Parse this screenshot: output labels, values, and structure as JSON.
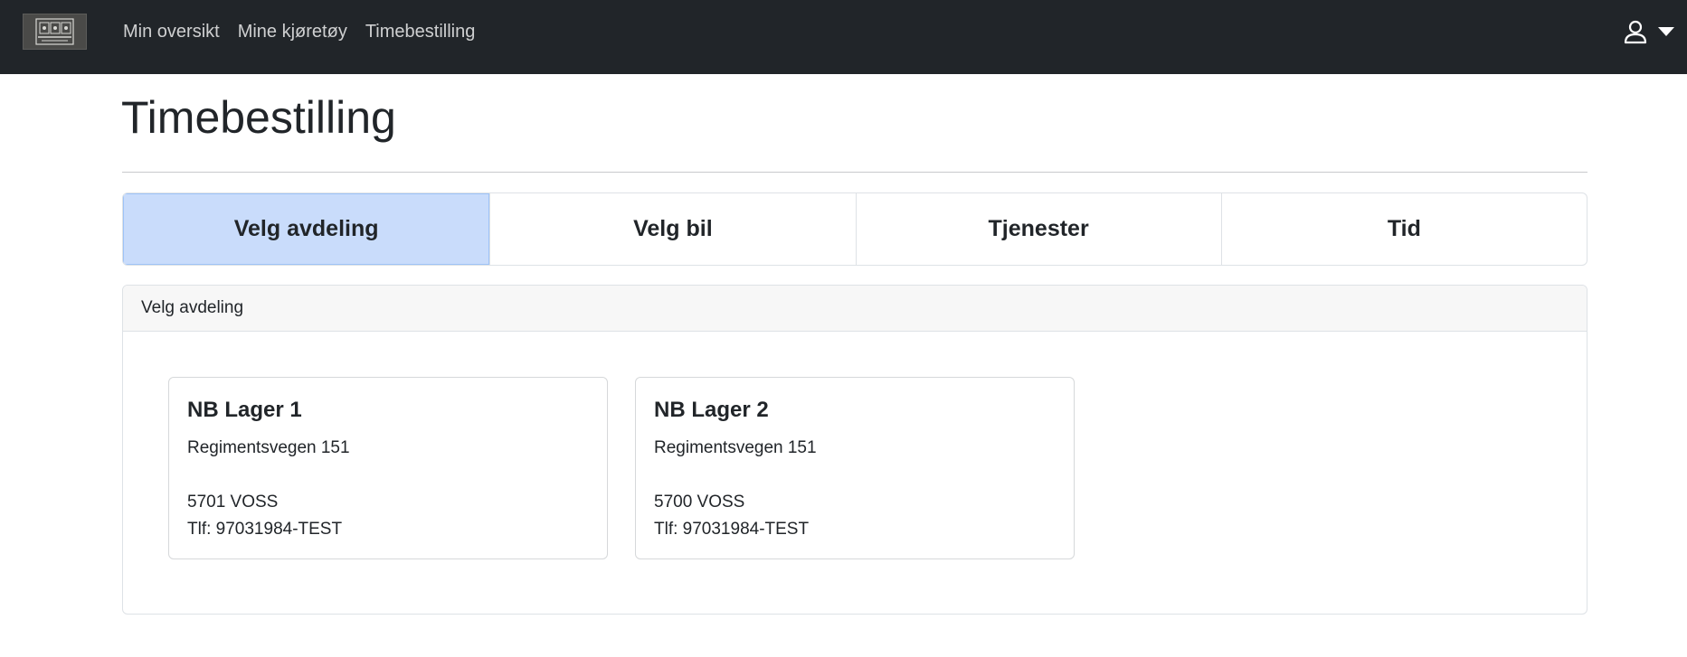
{
  "nav": {
    "links": [
      "Min oversikt",
      "Mine kjøretøy",
      "Timebestilling"
    ]
  },
  "page": {
    "title": "Timebestilling"
  },
  "steps": [
    "Velg avdeling",
    "Velg bil",
    "Tjenester",
    "Tid"
  ],
  "panel": {
    "header": "Velg avdeling",
    "departments": [
      {
        "name": "NB Lager 1",
        "street": "Regimentsvegen 151",
        "postal": "5701 VOSS",
        "phone": "Tlf: 97031984-TEST"
      },
      {
        "name": "NB Lager 2",
        "street": "Regimentsvegen 151",
        "postal": "5700 VOSS",
        "phone": "Tlf: 97031984-TEST"
      }
    ]
  },
  "colors": {
    "navbar_bg": "#212529",
    "active_step_bg": "#c9dcfb",
    "panel_header_bg": "#f7f7f7"
  },
  "icons": {
    "brand": "brand-logo",
    "user": "user-icon",
    "dropdown": "caret-down-icon"
  }
}
